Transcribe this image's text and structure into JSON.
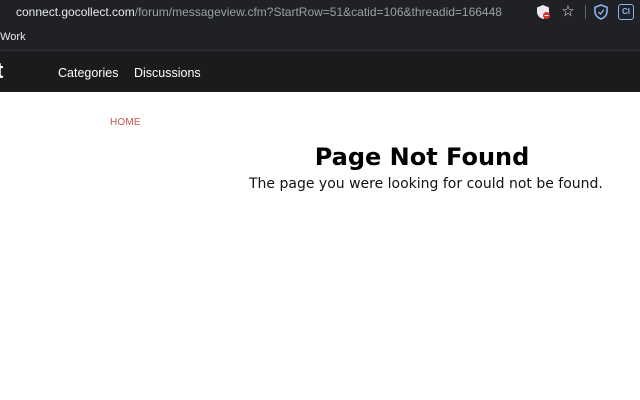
{
  "browser": {
    "url_host": "connect.gocollect.com",
    "url_path": "/forum/messageview.cfm?StartRow=51&catid=106&threadid=166448",
    "extension_ci_label": "CI",
    "bookmark_label": "t Work"
  },
  "header": {
    "logo_fragment": "t",
    "nav": {
      "categories": "Categories",
      "discussions": "Discussions"
    }
  },
  "breadcrumb": {
    "home": "HOME"
  },
  "error": {
    "title": "Page Not Found",
    "message": "The page you were looking for could not be found."
  },
  "colors": {
    "browser_chrome": "#202124",
    "site_header": "#1a1b1d",
    "breadcrumb_link": "#c9514b"
  }
}
